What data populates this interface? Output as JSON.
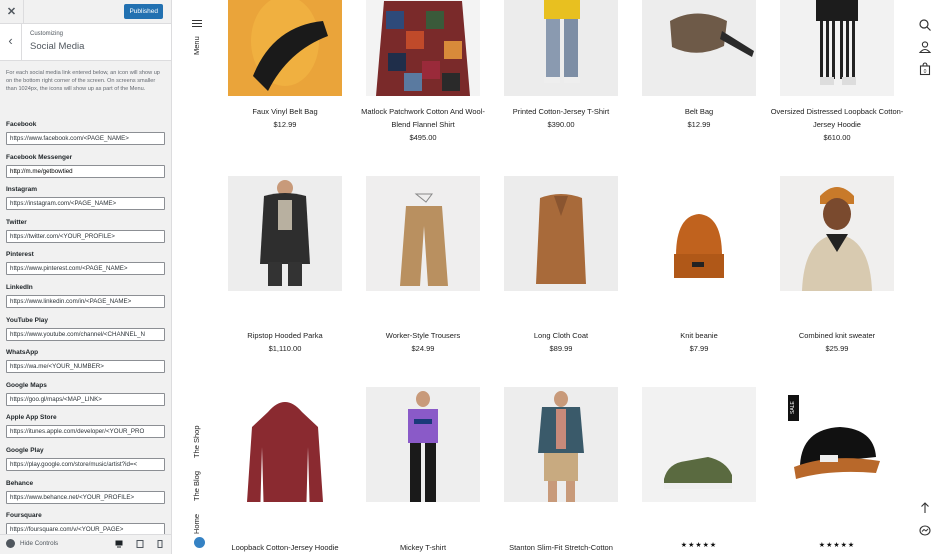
{
  "customizer": {
    "publish_label": "Published",
    "subtitle": "Customizing",
    "title": "Social Media",
    "description": "For each social media link entered below, an icon will show up on the bottom right corner of the screen. On screens smaller than 1024px, the icons will show up as part of the Menu.",
    "fields": [
      {
        "label": "Facebook",
        "value": "https://www.facebook.com/<PAGE_NAME>"
      },
      {
        "label": "Facebook Messenger",
        "value": "http://m.me/getbowtied"
      },
      {
        "label": "Instagram",
        "value": "https://instagram.com/<PAGE_NAME>"
      },
      {
        "label": "Twitter",
        "value": "https://twitter.com/<YOUR_PROFILE>"
      },
      {
        "label": "Pinterest",
        "value": "https://www.pinterest.com/<PAGE_NAME>"
      },
      {
        "label": "LinkedIn",
        "value": "https://www.linkedin.com/in/<PAGE_NAME>"
      },
      {
        "label": "YouTube Play",
        "value": "https://www.youtube.com/channel/<CHANNEL_N"
      },
      {
        "label": "WhatsApp",
        "value": "https://wa.me/<YOUR_NUMBER>"
      },
      {
        "label": "Google Maps",
        "value": "https://goo.gl/maps/<MAP_LINK>"
      },
      {
        "label": "Apple App Store",
        "value": "https://itunes.apple.com/developer/<YOUR_PRO"
      },
      {
        "label": "Google Play",
        "value": "https://play.google.com/store/music/artist?id=<"
      },
      {
        "label": "Behance",
        "value": "https://www.behance.net/<YOUR_PROFILE>"
      },
      {
        "label": "Foursquare",
        "value": "https://foursquare.com/v/<YOUR_PAGE>"
      }
    ],
    "hide_controls_label": "Hide Controls"
  },
  "nav": {
    "menu_label": "Menu",
    "links": [
      "The Shop",
      "The Blog",
      "Home"
    ]
  },
  "products": [
    {
      "name": "Faux Vinyl Belt Bag",
      "price": "$12.99"
    },
    {
      "name": "Matlock Patchwork Cotton And Wool-Blend Flannel Shirt",
      "price": "$495.00"
    },
    {
      "name": "Printed Cotton-Jersey T-Shirt",
      "price": "$390.00"
    },
    {
      "name": "Belt Bag",
      "price": "$12.99"
    },
    {
      "name": "Oversized Distressed Loopback Cotton-Jersey Hoodie",
      "price": "$610.00"
    },
    {
      "name": "Ripstop Hooded Parka",
      "price": "$1,110.00"
    },
    {
      "name": "Worker-Style Trousers",
      "price": "$24.99"
    },
    {
      "name": "Long Cloth Coat",
      "price": "$89.99"
    },
    {
      "name": "Knit beanie",
      "price": "$7.99"
    },
    {
      "name": "Combined knit sweater",
      "price": "$25.99"
    },
    {
      "name": "Loopback Cotton-Jersey Hoodie",
      "price": ""
    },
    {
      "name": "Mickey T-shirt",
      "price": ""
    },
    {
      "name": "Stanton Slim-Fit Stretch-Cotton",
      "price": ""
    },
    {
      "name": "",
      "price": "",
      "rating": "★★★★★"
    },
    {
      "name": "",
      "price": "",
      "rating": "★★★★★",
      "badge": "SALE"
    }
  ],
  "colors": {
    "accent": "#2271b1",
    "panel_bg": "#f1f1f1"
  }
}
